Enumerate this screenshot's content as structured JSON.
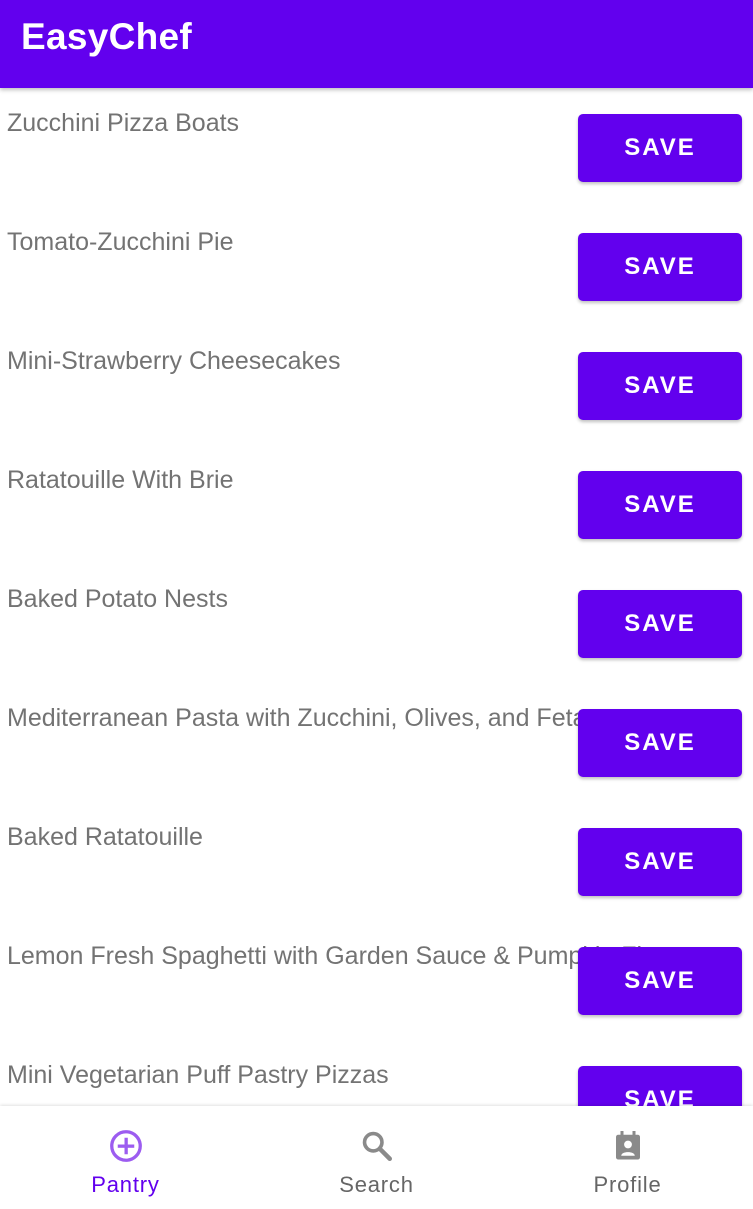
{
  "app": {
    "title": "EasyChef"
  },
  "recipes": [
    {
      "name": "Zucchini Pizza Boats",
      "save_label": "SAVE"
    },
    {
      "name": "Tomato-Zucchini Pie",
      "save_label": "SAVE"
    },
    {
      "name": "Mini-Strawberry Cheesecakes",
      "save_label": "SAVE"
    },
    {
      "name": "Ratatouille With Brie",
      "save_label": "SAVE"
    },
    {
      "name": "Baked Potato Nests",
      "save_label": "SAVE"
    },
    {
      "name": "Mediterranean Pasta with Zucchini, Olives, and Feta",
      "save_label": "SAVE"
    },
    {
      "name": "Baked Ratatouille",
      "save_label": "SAVE"
    },
    {
      "name": "Lemon Fresh Spaghetti with Garden Sauce & Pumpkin Flowers",
      "save_label": "SAVE"
    },
    {
      "name": "Mini Vegetarian Puff Pastry Pizzas",
      "save_label": "SAVE"
    }
  ],
  "bottom_nav": {
    "items": [
      {
        "label": "Pantry",
        "icon": "add-circle-icon",
        "active": true
      },
      {
        "label": "Search",
        "icon": "search-icon",
        "active": false
      },
      {
        "label": "Profile",
        "icon": "contact-calendar-icon",
        "active": false
      }
    ]
  },
  "colors": {
    "primary": "#6200EE",
    "text_secondary": "#737373",
    "nav_inactive": "#666666",
    "icon_inactive": "#8a8a8a",
    "icon_active": "#9C5CF0"
  }
}
